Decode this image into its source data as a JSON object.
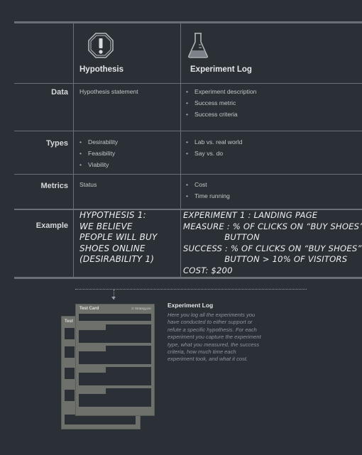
{
  "columns": {
    "hypothesis": {
      "label": "Hypothesis",
      "icon": "warning-octagon-icon"
    },
    "experiment_log": {
      "label": "Experiment Log",
      "icon": "flask-icon"
    }
  },
  "rows": {
    "data": {
      "label": "Data",
      "hypothesis": "Hypothesis statement",
      "experiment": [
        "Experiment description",
        "Success metric",
        "Success criteria"
      ]
    },
    "types": {
      "label": "Types",
      "hypothesis": [
        "Desirability",
        "Feasibility",
        "Viability"
      ],
      "experiment": [
        "Lab vs. real world",
        "Say vs. do"
      ]
    },
    "metrics": {
      "label": "Metrics",
      "hypothesis": "Status",
      "experiment": [
        "Cost",
        "Time running"
      ]
    },
    "example": {
      "label": "Example",
      "hypothesis": "Hypothesis 1:\nWe believe\npeople will buy\nshoes online\n(desirability 1)",
      "experiment": "Experiment 1 : Landing page\nMeasure : % of clicks on “buy shoes”\n               button\nSuccess : % of clicks on “buy shoes”\n               button > 10% of visitors\nCost: $200"
    }
  },
  "card": {
    "front_title": "Test Card",
    "front_brand": "Strategyzer",
    "back_title": "Test"
  },
  "description": {
    "title": "Experiment Log",
    "body": "Here you log all the experiments you have conducted to either support or refute a specific hypothesis. For each experiment you capture the experiment type, what you measured, the success criteria, how much time each experiment took, and what it cost."
  }
}
